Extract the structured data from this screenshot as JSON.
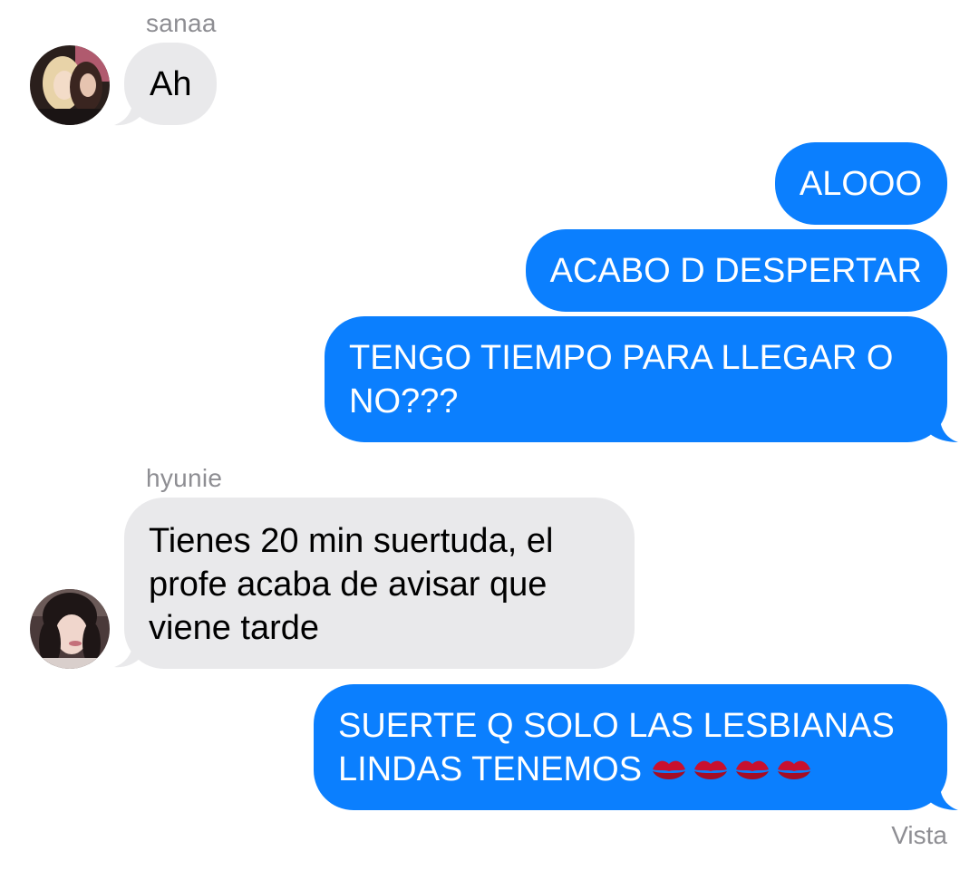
{
  "conversation": {
    "messages": [
      {
        "sender": "sanaa",
        "direction": "incoming",
        "text": "Ah"
      },
      {
        "direction": "outgoing",
        "text": "ALOOO"
      },
      {
        "direction": "outgoing",
        "text": "ACABO D DESPERTAR"
      },
      {
        "direction": "outgoing",
        "text": "TENGO TIEMPO PARA LLEGAR O NO???"
      },
      {
        "sender": "hyunie",
        "direction": "incoming",
        "text": "Tienes 20 min suertuda, el profe acaba de avisar que viene tarde"
      },
      {
        "direction": "outgoing",
        "text": "SUERTE Q SOLO LAS LESBIANAS LINDAS TENEMOS",
        "emoji": [
          "kiss-mark",
          "kiss-mark",
          "kiss-mark",
          "kiss-mark"
        ]
      }
    ],
    "senders": {
      "sender_1": "sanaa",
      "sender_2": "hyunie"
    },
    "lines": {
      "m1": "Ah",
      "m2": "ALOOO",
      "m3": "ACABO D DESPERTAR",
      "m4_line1": "TENGO TIEMPO PARA LLEGAR O",
      "m4_line2": "NO???",
      "m5_line1": "Tienes 20 min suertuda, el",
      "m5_line2": "profe acaba de avisar que",
      "m5_line3": "viene tarde",
      "m6_line1": "SUERTE Q SOLO LAS LESBIANAS",
      "m6_line2": "LINDAS TENEMOS"
    },
    "read_receipt": "Vista"
  },
  "colors": {
    "outgoing_bubble": "#0b7ffe",
    "incoming_bubble": "#e9e9eb",
    "meta_text": "#8e8e93",
    "kiss_emoji": "#c8102e"
  },
  "icons": [
    "avatar-sanaa",
    "avatar-hyunie",
    "kiss-mark-emoji"
  ]
}
